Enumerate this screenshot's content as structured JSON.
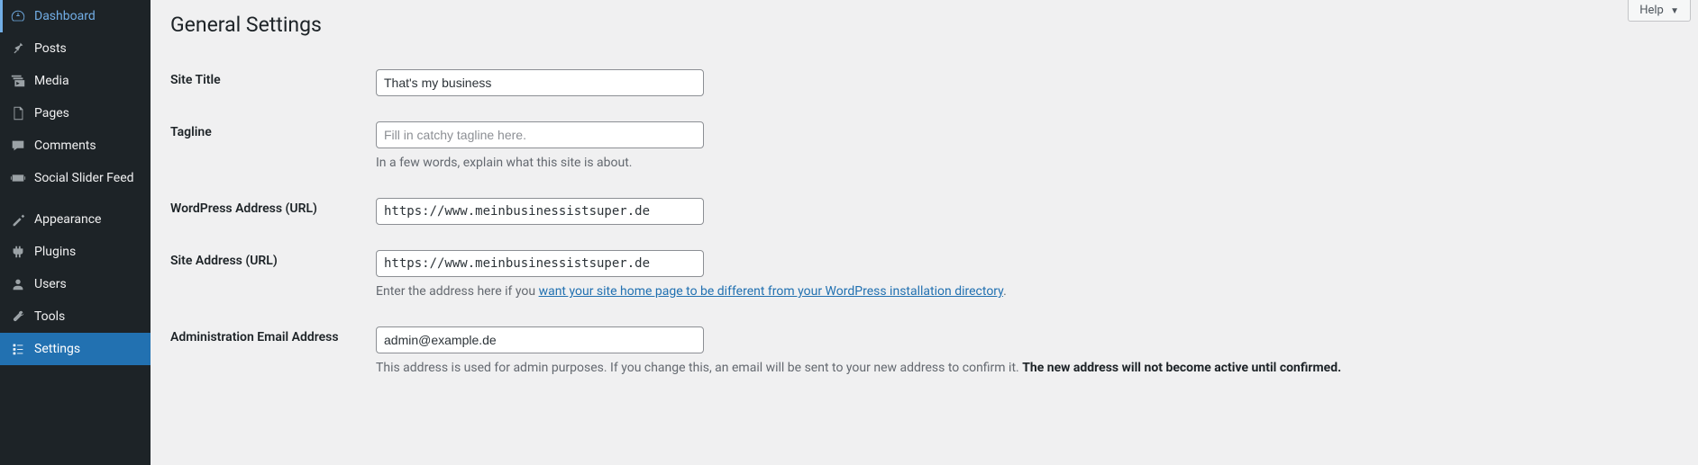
{
  "sidebar": {
    "items": [
      {
        "label": "Dashboard",
        "icon": "dashboard"
      },
      {
        "label": "Posts",
        "icon": "pin"
      },
      {
        "label": "Media",
        "icon": "media"
      },
      {
        "label": "Pages",
        "icon": "pages"
      },
      {
        "label": "Comments",
        "icon": "comments"
      },
      {
        "label": "Social Slider Feed",
        "icon": "slider"
      },
      {
        "label": "Appearance",
        "icon": "appearance"
      },
      {
        "label": "Plugins",
        "icon": "plugins"
      },
      {
        "label": "Users",
        "icon": "users"
      },
      {
        "label": "Tools",
        "icon": "tools"
      },
      {
        "label": "Settings",
        "icon": "settings"
      }
    ]
  },
  "header": {
    "help": "Help",
    "title": "General Settings"
  },
  "fields": {
    "site_title": {
      "label": "Site Title",
      "value": "That's my business"
    },
    "tagline": {
      "label": "Tagline",
      "placeholder": "Fill in catchy tagline here.",
      "desc": "In a few words, explain what this site is about."
    },
    "wp_url": {
      "label": "WordPress Address (URL)",
      "value": "https://www.meinbusinessistsuper.de"
    },
    "site_url": {
      "label": "Site Address (URL)",
      "value": "https://www.meinbusinessistsuper.de",
      "desc_pre": "Enter the address here if you ",
      "desc_link": "want your site home page to be different from your WordPress installation directory",
      "desc_post": "."
    },
    "admin_email": {
      "label": "Administration Email Address",
      "value": "admin@example.de",
      "desc_pre": "This address is used for admin purposes. If you change this, an email will be sent to your new address to confirm it. ",
      "desc_strong": "The new address will not become active until confirmed."
    }
  }
}
